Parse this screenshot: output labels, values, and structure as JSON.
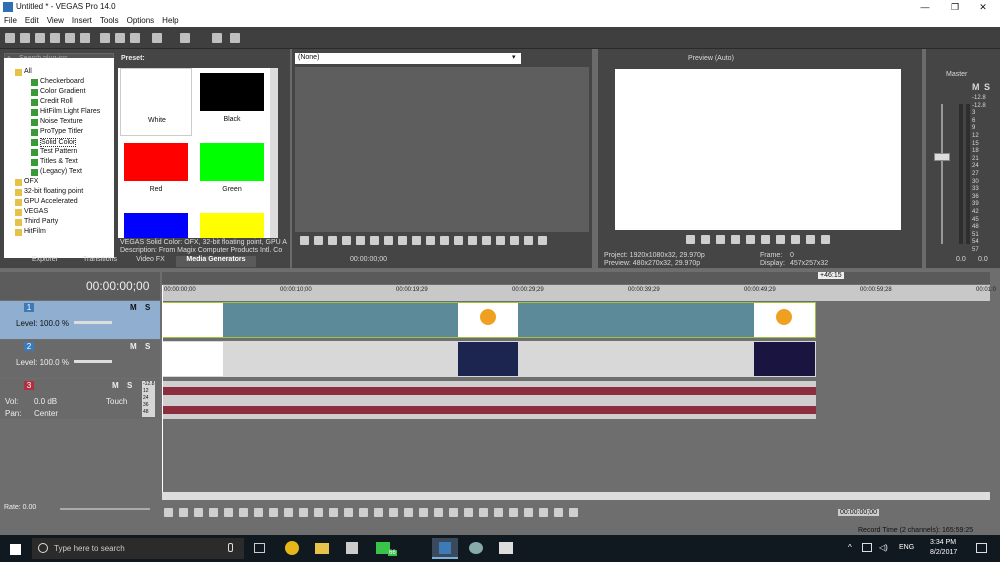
{
  "window": {
    "title": "Untitled * - VEGAS Pro 14.0",
    "minimize": "—",
    "maximize": "❐",
    "close": "✕"
  },
  "menu": [
    "File",
    "Edit",
    "View",
    "Insert",
    "Tools",
    "Options",
    "Help"
  ],
  "explorer": {
    "search_placeholder": "Search plug-ins",
    "preset_label": "Preset:",
    "tree": [
      {
        "label": "All",
        "depth": 0
      },
      {
        "label": "Checkerboard",
        "depth": 1
      },
      {
        "label": "Color Gradient",
        "depth": 1
      },
      {
        "label": "Credit Roll",
        "depth": 1
      },
      {
        "label": "HitFilm Light Flares",
        "depth": 1
      },
      {
        "label": "Noise Texture",
        "depth": 1
      },
      {
        "label": "ProType Titler",
        "depth": 1
      },
      {
        "label": "Solid Color",
        "depth": 1
      },
      {
        "label": "Test Pattern",
        "depth": 1
      },
      {
        "label": "Titles & Text",
        "depth": 1
      },
      {
        "label": "(Legacy) Text",
        "depth": 1
      },
      {
        "label": "OFX",
        "depth": 0
      },
      {
        "label": "32-bit floating point",
        "depth": 0
      },
      {
        "label": "GPU Accelerated",
        "depth": 0
      },
      {
        "label": "VEGAS",
        "depth": 0
      },
      {
        "label": "Third Party",
        "depth": 0
      },
      {
        "label": "HitFilm",
        "depth": 0
      }
    ],
    "presets": [
      {
        "label": "White",
        "color": "#ffffff"
      },
      {
        "label": "Black",
        "color": "#000000"
      },
      {
        "label": "Red",
        "color": "#ff0000"
      },
      {
        "label": "Green",
        "color": "#00ff00"
      },
      {
        "label": "",
        "color": "#0000ff"
      },
      {
        "label": "",
        "color": "#ffff00"
      }
    ],
    "desc1": "VEGAS Solid Color: OFX, 32-bit floating point, GPU A",
    "desc2": "Description: From Magix Computer Products Intl. Co",
    "tabs": [
      "Explorer",
      "Transitions",
      "Video FX",
      "Media Generators"
    ]
  },
  "trimmer": {
    "select": "(None)",
    "time": "00:00:00;00"
  },
  "preview": {
    "mode": "Preview (Auto)",
    "project": "Project:   1920x1080x32, 29.970p",
    "preview": "Preview:   480x270x32, 29.970p",
    "frame_label": "Frame:",
    "frame_value": "0",
    "display_label": "Display:",
    "display_value": "457x257x32"
  },
  "mixer": {
    "title": "Master",
    "m": "M",
    "s": "S",
    "scale": [
      "-12.8",
      "-12.8",
      "3",
      "6",
      "9",
      "12",
      "15",
      "18",
      "21",
      "24",
      "27",
      "30",
      "33",
      "36",
      "39",
      "42",
      "45",
      "48",
      "51",
      "54",
      "57"
    ],
    "bottom": [
      "0.0",
      "0.0"
    ]
  },
  "timeline": {
    "timecode": "00:00:00;00",
    "ruler": [
      "00:00:00;00",
      "00:00:10;00",
      "00:00:19;29",
      "00:00:29;29",
      "00:00:39;29",
      "00:00:49;29",
      "00:00:59;28",
      "00:01:0"
    ],
    "tail": "+46:15",
    "tracks": [
      {
        "num": "1",
        "level_label": "Level: 100.0 %"
      },
      {
        "num": "2",
        "level_label": "Level: 100.0 %"
      },
      {
        "num": "3",
        "vol_label": "Vol:",
        "vol_value": "0.0 dB",
        "pan_label": "Pan:",
        "pan_value": "Center",
        "touch": "Touch",
        "meter": [
          "-12.8",
          "12",
          "24",
          "36",
          "48"
        ]
      }
    ],
    "rate": "Rate: 0.00",
    "bottom_time": "00:00:00;00",
    "record_time": "Record Time (2 channels): 165:59:25"
  },
  "taskbar": {
    "search": "Type here to search",
    "badge": "66",
    "lang": "ENG",
    "time": "3:34 PM",
    "date": "8/2/2017"
  },
  "colors": {
    "accent": "#3d7ab8",
    "clip": "#5d8a99",
    "audio": "#8c2e3e"
  }
}
